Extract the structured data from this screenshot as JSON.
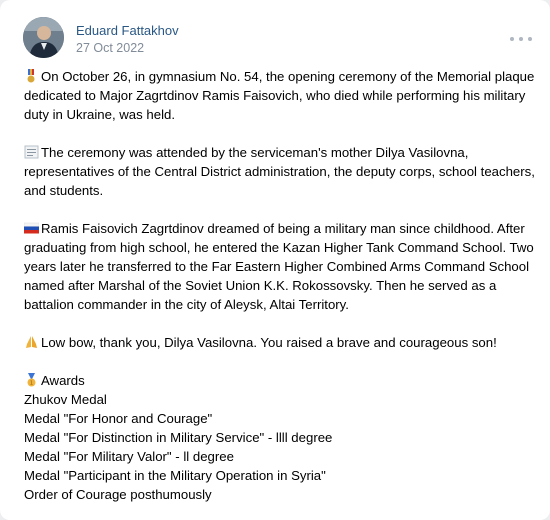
{
  "post": {
    "author": "Eduard Fattakhov",
    "date": "27 Oct 2022",
    "paragraphs": [
      {
        "icon": "military-medal-icon",
        "lines": [
          "On October 26, in gymnasium No. 54, the opening ceremony of the Memorial plaque",
          "dedicated to Major Zagrtdinov Ramis Faisovich, who died while performing his military",
          "duty in Ukraine, was held."
        ]
      },
      {
        "icon": "page-icon",
        "lines": [
          "The ceremony was attended by the serviceman's mother Dilya Vasilovna,",
          "representatives of the Central District administration, the deputy corps, school teachers,",
          "and students."
        ]
      },
      {
        "icon": "russia-flag-icon",
        "lines": [
          "Ramis Faisovich Zagrtdinov dreamed of being a military man since childhood. After",
          "graduating from high school, he entered the Kazan Higher Tank Command School. Two",
          "years later he transferred to the Far Eastern Higher Combined Arms Command School",
          "named after Marshal of the Soviet Union K.K. Rokossovsky. Then he served as a",
          "battalion commander in the city of Aleysk, Altai Territory."
        ]
      },
      {
        "icon": "folded-hands-icon",
        "lines": [
          "Low bow, thank you, Dilya Vasilovna. You raised a brave and courageous son!"
        ]
      },
      {
        "icon": "medal-icon",
        "lines": [
          "Awards",
          "Zhukov Medal",
          "Medal \"For Honor and Courage\"",
          "Medal \"For Distinction in Military Service\" - llll degree",
          "Medal \"For Military Valor\" - ll degree",
          "Medal \"Participant in the Military Operation in Syria\"",
          "Order of Courage posthumously"
        ]
      }
    ]
  },
  "colors": {
    "author": "#2a5885",
    "date": "#818c99",
    "text": "#000000",
    "background": "#ffffff"
  }
}
